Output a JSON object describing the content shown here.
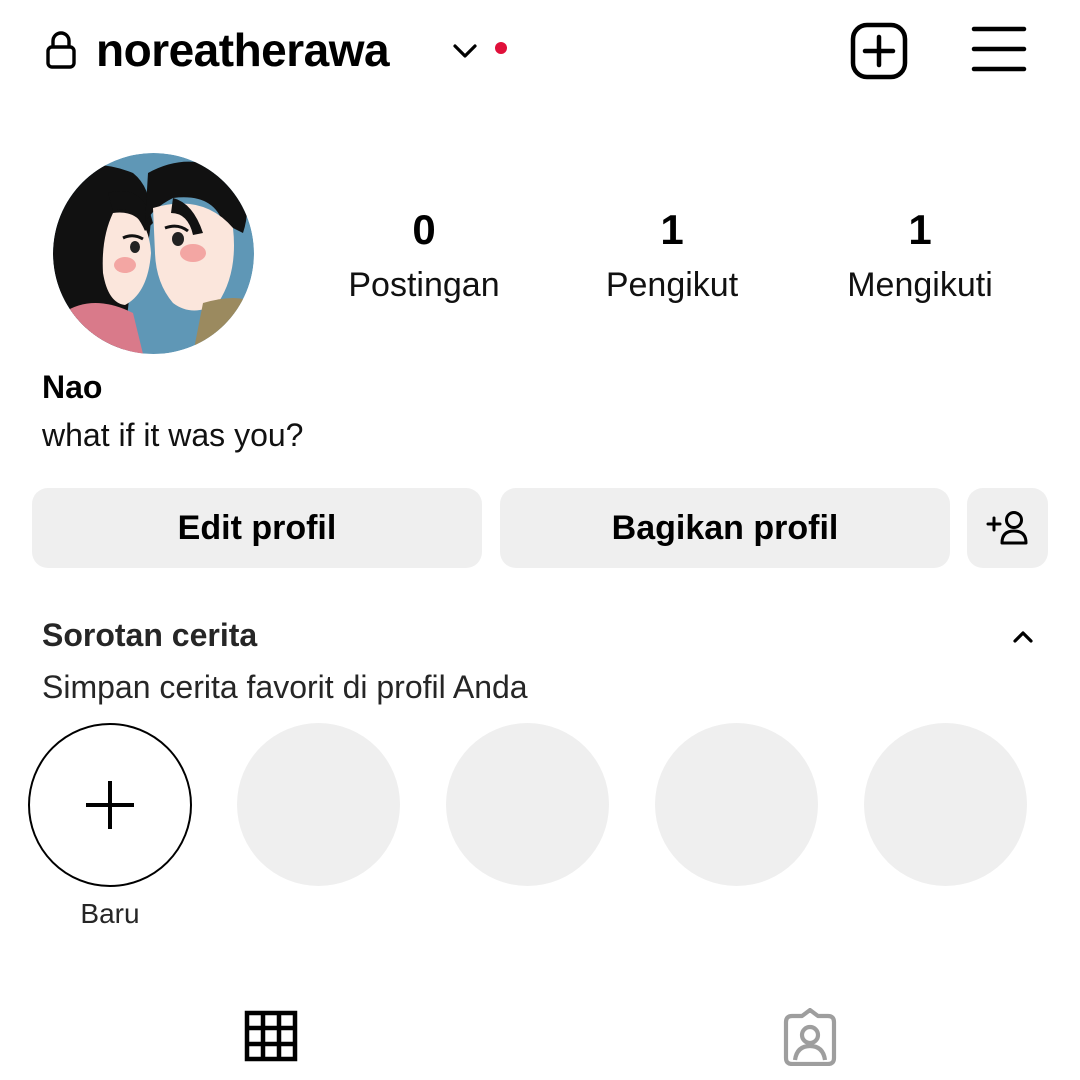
{
  "colors": {
    "notification_dot": "#e0103a",
    "button_bg": "#efefef",
    "placeholder_bg": "#efefef",
    "muted_icon": "#9e9e9e"
  },
  "header": {
    "username": "noreatherawa",
    "icons": [
      "lock-icon",
      "chevron-down-icon",
      "notification-dot",
      "create-post-icon",
      "hamburger-menu-icon"
    ]
  },
  "profile": {
    "display_name": "Nao",
    "bio": "what if it was you?",
    "avatar": "anime-couple-avatar"
  },
  "stats": [
    {
      "value": "0",
      "label": "Postingan"
    },
    {
      "value": "1",
      "label": "Pengikut"
    },
    {
      "value": "1",
      "label": "Mengikuti"
    }
  ],
  "buttons": {
    "edit_profile": "Edit profil",
    "share_profile": "Bagikan profil",
    "add_user_icon": "add-user-icon"
  },
  "highlights": {
    "title": "Sorotan cerita",
    "subtitle": "Simpan cerita favorit di profil Anda",
    "new_label": "Baru",
    "placeholder_count": 4
  },
  "tabs": [
    "grid-icon",
    "tagged-icon"
  ]
}
